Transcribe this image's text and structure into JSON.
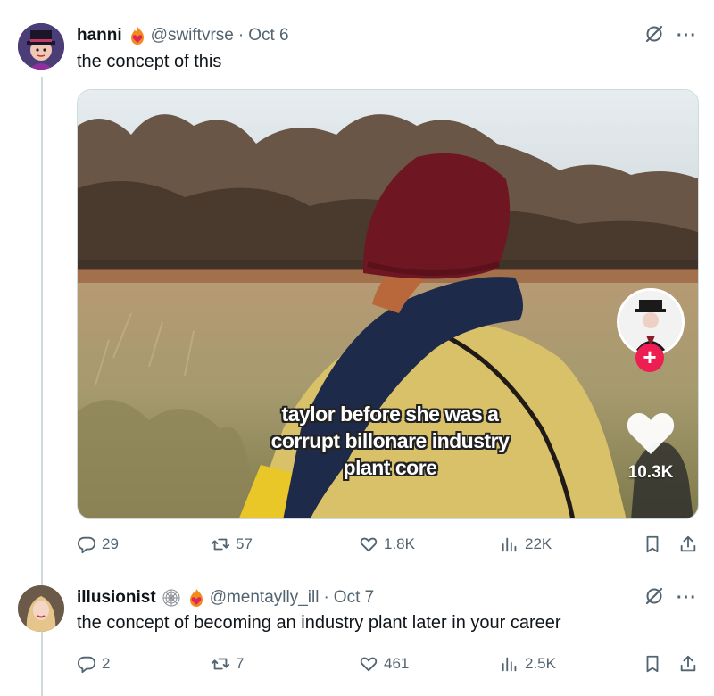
{
  "tweet1": {
    "name": "hanni",
    "handle": "@swiftvrse",
    "separator": "·",
    "date": "Oct 6",
    "text": "the concept of this",
    "more": "···",
    "media": {
      "caption_line1": "taylor before she was a",
      "caption_line2": "corrupt billonare industry",
      "caption_line3": "plant core",
      "like_count": "10.3K",
      "follow_plus": "+"
    },
    "stats": {
      "replies": "29",
      "retweets": "57",
      "likes": "1.8K",
      "views": "22K"
    }
  },
  "tweet2": {
    "name": "illusionist",
    "handle": "@mentaylly_ill",
    "separator": "·",
    "date": "Oct 7",
    "text": "the concept of becoming an industry plant later in your career",
    "more": "···",
    "stats": {
      "replies": "2",
      "retweets": "7",
      "likes": "461",
      "views": "2.5K"
    }
  },
  "icons": {
    "reply": "reply-icon",
    "retweet": "retweet-icon",
    "like": "heart-icon",
    "views": "views-icon",
    "bookmark": "bookmark-icon",
    "share": "share-icon",
    "grok": "grok-icon",
    "more": "more-icon"
  },
  "colors": {
    "text": "#0f1419",
    "secondary": "#536471",
    "thread_line": "#cfd9de",
    "tiktok_red": "#ee1d52"
  }
}
